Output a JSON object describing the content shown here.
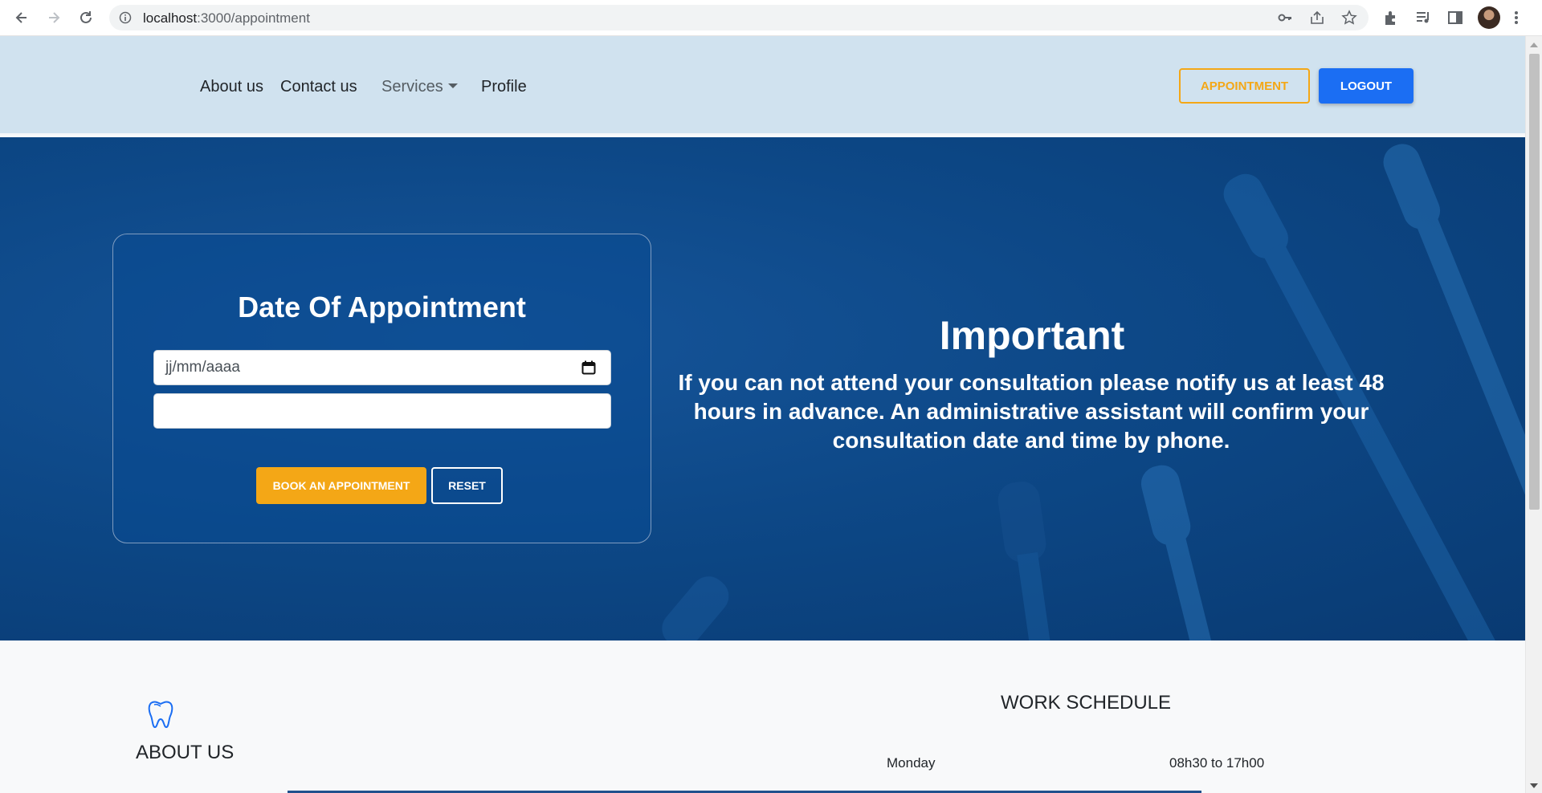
{
  "browser": {
    "url_host": "localhost",
    "url_path": ":3000/appointment"
  },
  "navbar": {
    "links": {
      "about": "About us",
      "contact": "Contact us",
      "services": "Services",
      "profile": "Profile"
    },
    "appointment_button": "APPOINTMENT",
    "logout_button": "LOGOUT"
  },
  "form": {
    "title": "Date Of Appointment",
    "date_placeholder": "jj/mm/aaaa",
    "time_value": "",
    "book_button": "BOOK AN APPOINTMENT",
    "reset_button": "RESET"
  },
  "notice": {
    "title": "Important",
    "text": "If you can not attend your consultation please notify us at least 48 hours in advance. An administrative assistant will confirm your consultation date and time by phone."
  },
  "footer": {
    "about_title": "ABOUT US",
    "schedule_title": "WORK SCHEDULE",
    "schedule": [
      {
        "day": "Monday",
        "hours": "08h30 to 17h00"
      }
    ]
  },
  "colors": {
    "navbar_bg": "#d0e2ef",
    "hero_bg": "#0d4887",
    "accent_orange": "#f4a716",
    "primary_blue": "#1b6ef3"
  }
}
